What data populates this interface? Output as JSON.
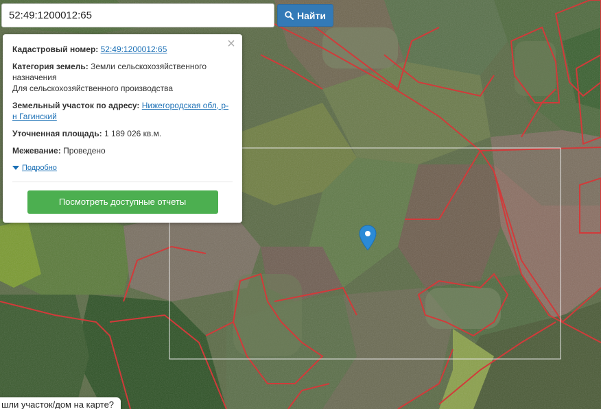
{
  "search": {
    "value": "52:49:1200012:65",
    "button_label": "Найти"
  },
  "popup": {
    "cadastral_label": "Кадастровый номер:",
    "cadastral_value": "52:49:1200012:65",
    "category_label": "Категория земель:",
    "category_value": "Земли сельскохозяйственного назначения",
    "category_use": "Для сельскохозяйственного производства",
    "address_label": "Земельный участок по адресу:",
    "address_value": "Нижегородская обл, р-н Гагинский",
    "area_label": "Уточненная площадь:",
    "area_value": "1 189 026 кв.м.",
    "survey_label": "Межевание:",
    "survey_value": "Проведено",
    "more_label": "Подробно",
    "report_button": "Посмотреть доступные отчеты",
    "close_icon": "close-icon"
  },
  "bottom_tip": "шли участок/дом на карте?",
  "colors": {
    "boundary": "#d23a3a",
    "accent_button": "#337ab7",
    "report_button": "#4caf50",
    "marker": "#2b8ad6"
  }
}
